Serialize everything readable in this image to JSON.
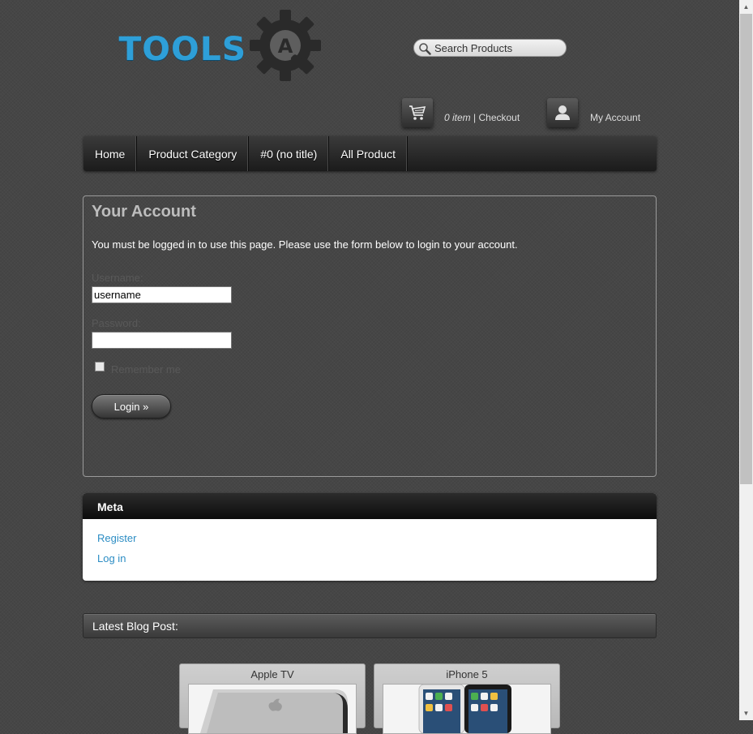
{
  "header": {
    "logo_text": "TOOLS",
    "logo_gear_letter": "A",
    "search": {
      "placeholder": "Search Products",
      "value": ""
    },
    "cart": {
      "count": "0 item",
      "separator": " | ",
      "checkout_label": "Checkout"
    },
    "account_label": "My Account"
  },
  "nav": {
    "items": [
      {
        "label": "Home"
      },
      {
        "label": "Product Category"
      },
      {
        "label": "#0 (no title)"
      },
      {
        "label": "All Product"
      }
    ]
  },
  "account": {
    "title": "Your Account",
    "message": "You must be logged in to use this page. Please use the form below to login to your account.",
    "username_label": "Username:",
    "username_value": "username",
    "password_label": "Password:",
    "password_value": "",
    "remember_label": "Remember me",
    "remember_checked": false,
    "login_button": "Login »"
  },
  "meta": {
    "title": "Meta",
    "links": [
      {
        "label": "Register"
      },
      {
        "label": "Log in"
      }
    ]
  },
  "blog": {
    "title": "Latest Blog Post:",
    "posts": [
      {
        "title": "Apple TV"
      },
      {
        "title": "iPhone 5"
      }
    ]
  },
  "colors": {
    "logo_blue": "#2e9fd8",
    "link_blue": "#2c8dc4",
    "background": "#464646"
  }
}
